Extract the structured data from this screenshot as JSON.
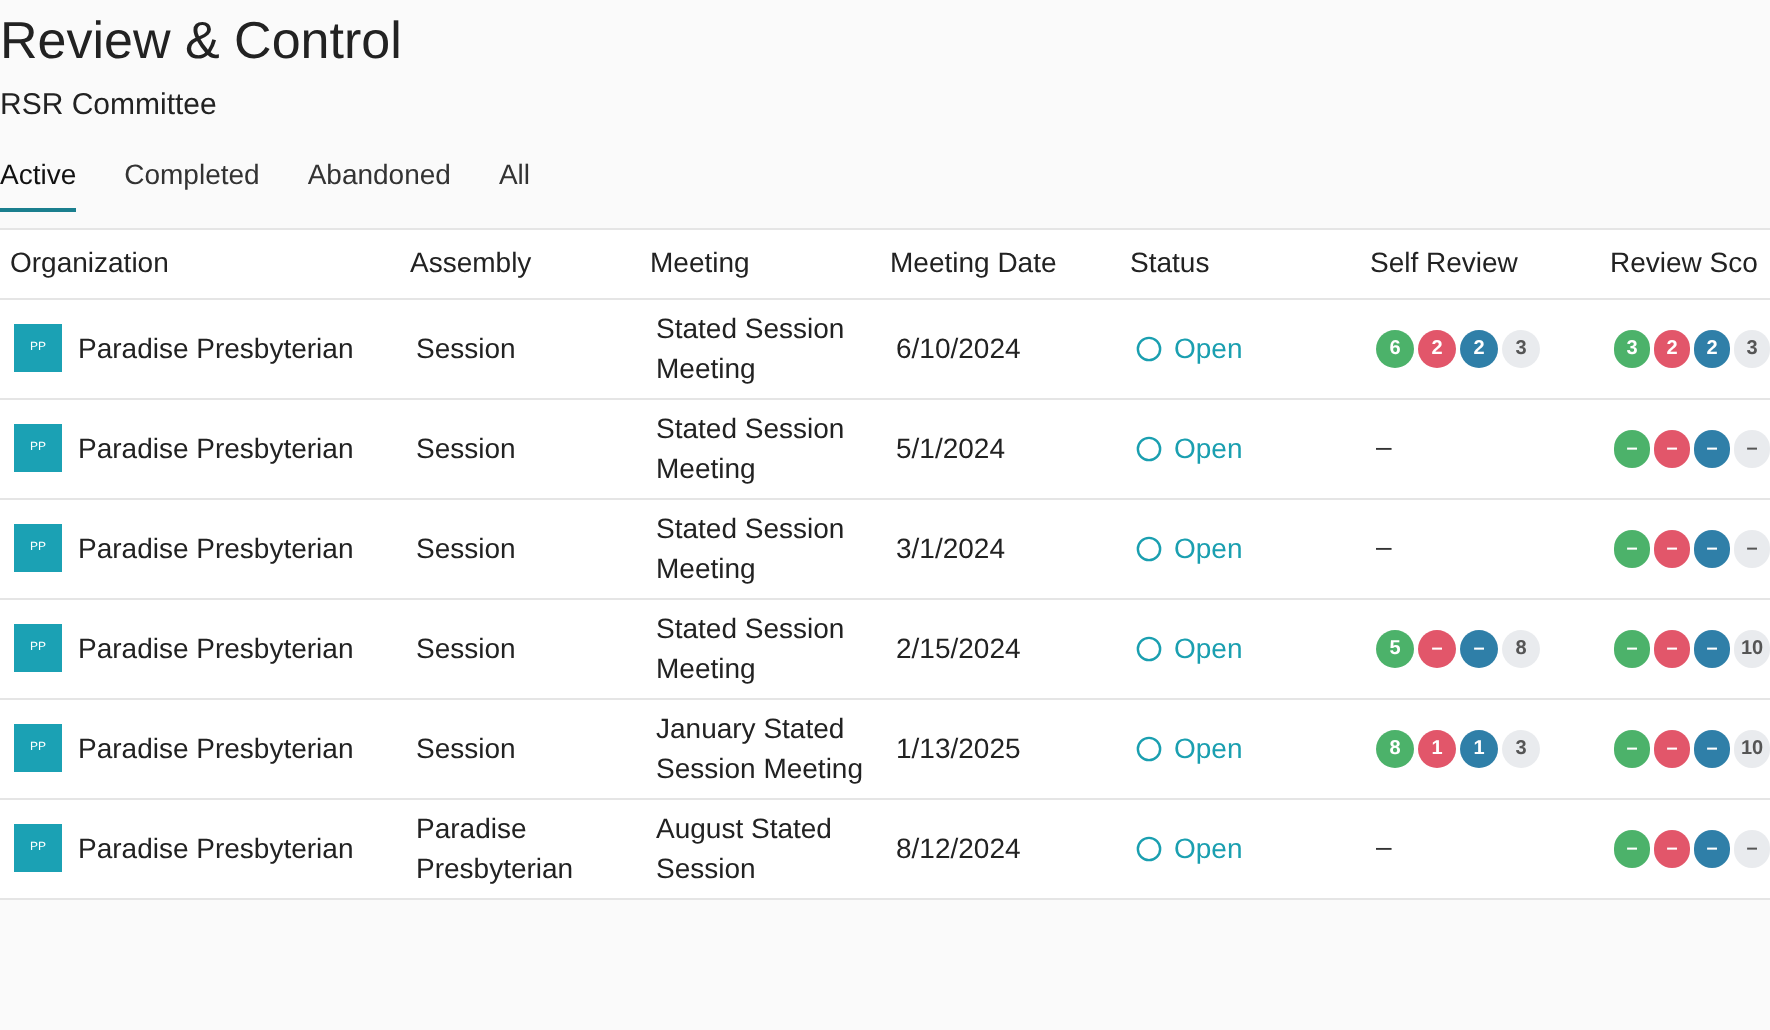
{
  "page": {
    "title": "Review & Control",
    "subtitle": "RSR Committee"
  },
  "tabs": [
    {
      "label": "Active",
      "selected": true
    },
    {
      "label": "Completed",
      "selected": false
    },
    {
      "label": "Abandoned",
      "selected": false
    },
    {
      "label": "All",
      "selected": false
    }
  ],
  "table": {
    "columns": [
      "Organization",
      "Assembly",
      "Meeting",
      "Meeting Date",
      "Status",
      "Self Review",
      "Review Sco"
    ],
    "rows": [
      {
        "avatar": "PP",
        "organization": "Paradise Presbyterian",
        "assembly": "Session",
        "meeting": "Stated Session Meeting",
        "date": "6/10/2024",
        "status": "Open",
        "self_review": {
          "badges": [
            {
              "text": "6",
              "color": "#4cb26a"
            },
            {
              "text": "2",
              "color": "#e2566a"
            },
            {
              "text": "2",
              "color": "#2f7fa8"
            },
            {
              "text": "3",
              "color": "#e9ebee"
            }
          ]
        },
        "review_score": {
          "badges": [
            {
              "text": "3",
              "color": "#4cb26a"
            },
            {
              "text": "2",
              "color": "#e2566a"
            },
            {
              "text": "2",
              "color": "#2f7fa8"
            },
            {
              "text": "3",
              "color": "#e9ebee"
            }
          ]
        }
      },
      {
        "avatar": "PP",
        "organization": "Paradise Presbyterian",
        "assembly": "Session",
        "meeting": "Stated Session Meeting",
        "date": "5/1/2024",
        "status": "Open",
        "self_review": {
          "text": "–"
        },
        "review_score": {
          "badges": [
            {
              "text": "–",
              "color": "#4cb26a"
            },
            {
              "text": "–",
              "color": "#e2566a"
            },
            {
              "text": "–",
              "color": "#2f7fa8"
            },
            {
              "text": "–",
              "color": "#e9ebee"
            }
          ]
        }
      },
      {
        "avatar": "PP",
        "organization": "Paradise Presbyterian",
        "assembly": "Session",
        "meeting": "Stated Session Meeting",
        "date": "3/1/2024",
        "status": "Open",
        "self_review": {
          "text": "–"
        },
        "review_score": {
          "badges": [
            {
              "text": "–",
              "color": "#4cb26a"
            },
            {
              "text": "–",
              "color": "#e2566a"
            },
            {
              "text": "–",
              "color": "#2f7fa8"
            },
            {
              "text": "–",
              "color": "#e9ebee"
            }
          ]
        }
      },
      {
        "avatar": "PP",
        "organization": "Paradise Presbyterian",
        "assembly": "Session",
        "meeting": "Stated Session Meeting",
        "date": "2/15/2024",
        "status": "Open",
        "self_review": {
          "badges": [
            {
              "text": "5",
              "color": "#4cb26a"
            },
            {
              "text": "–",
              "color": "#e2566a"
            },
            {
              "text": "–",
              "color": "#2f7fa8"
            },
            {
              "text": "8",
              "color": "#e9ebee"
            }
          ]
        },
        "review_score": {
          "badges": [
            {
              "text": "–",
              "color": "#4cb26a"
            },
            {
              "text": "–",
              "color": "#e2566a"
            },
            {
              "text": "–",
              "color": "#2f7fa8"
            },
            {
              "text": "10",
              "color": "#e9ebee"
            }
          ]
        }
      },
      {
        "avatar": "PP",
        "organization": "Paradise Presbyterian",
        "assembly": "Session",
        "meeting": "January Stated Session Meeting",
        "date": "1/13/2025",
        "status": "Open",
        "self_review": {
          "badges": [
            {
              "text": "8",
              "color": "#4cb26a"
            },
            {
              "text": "1",
              "color": "#e2566a"
            },
            {
              "text": "1",
              "color": "#2f7fa8"
            },
            {
              "text": "3",
              "color": "#e9ebee"
            }
          ]
        },
        "review_score": {
          "badges": [
            {
              "text": "–",
              "color": "#4cb26a"
            },
            {
              "text": "–",
              "color": "#e2566a"
            },
            {
              "text": "–",
              "color": "#2f7fa8"
            },
            {
              "text": "10",
              "color": "#e9ebee"
            }
          ]
        }
      },
      {
        "avatar": "PP",
        "organization": "Paradise Presbyterian",
        "assembly": "Paradise Presbyterian",
        "meeting": "August Stated Session",
        "date": "8/12/2024",
        "status": "Open",
        "self_review": {
          "text": "–"
        },
        "review_score": {
          "badges": [
            {
              "text": "–",
              "color": "#4cb26a"
            },
            {
              "text": "–",
              "color": "#e2566a"
            },
            {
              "text": "–",
              "color": "#2f7fa8"
            },
            {
              "text": "–",
              "color": "#e9ebee"
            }
          ]
        }
      }
    ]
  }
}
